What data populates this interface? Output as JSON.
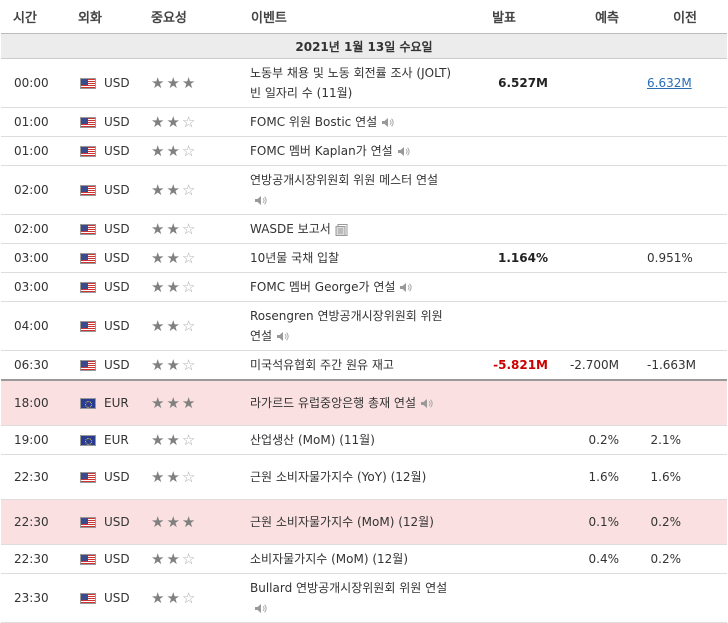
{
  "headers": {
    "time": "시간",
    "currency": "외화",
    "importance": "중요성",
    "event": "이벤트",
    "actual": "발표",
    "forecast": "예측",
    "previous": "이전"
  },
  "date_label": "2021년 1월 13일 수요일",
  "icons": {
    "us_flag": "us-flag-icon",
    "eu_flag": "eu-flag-icon",
    "star": "star-icon",
    "speaker": "speaker-icon",
    "document": "document-icon"
  },
  "colors": {
    "highlight_row": "#fae0e0",
    "negative": "#c00000",
    "link": "#2a6db5"
  },
  "rows": [
    {
      "time": "00:00",
      "flag": "us",
      "currency": "USD",
      "stars": 3,
      "event": "노동부 채용 및 노동 회전률 조사 (JOLT) 빈 일자리 수 (11월)",
      "icon": "",
      "actual": "6.527M",
      "actual_neg": false,
      "forecast": "",
      "previous": "6.632M",
      "previous_link": true,
      "hl": false
    },
    {
      "time": "01:00",
      "flag": "us",
      "currency": "USD",
      "stars": 2,
      "event": "FOMC 위원 Bostic 연설",
      "icon": "speaker",
      "actual": "",
      "forecast": "",
      "previous": "",
      "hl": false
    },
    {
      "time": "01:00",
      "flag": "us",
      "currency": "USD",
      "stars": 2,
      "event": "FOMC 멤버 Kaplan가 연설",
      "icon": "speaker",
      "actual": "",
      "forecast": "",
      "previous": "",
      "hl": false
    },
    {
      "time": "02:00",
      "flag": "us",
      "currency": "USD",
      "stars": 2,
      "event": "연방공개시장위원회 위원 메스터 연설",
      "icon": "speaker",
      "actual": "",
      "forecast": "",
      "previous": "",
      "hl": false
    },
    {
      "time": "02:00",
      "flag": "us",
      "currency": "USD",
      "stars": 2,
      "event": "WASDE 보고서",
      "icon": "document",
      "actual": "",
      "forecast": "",
      "previous": "",
      "hl": false
    },
    {
      "time": "03:00",
      "flag": "us",
      "currency": "USD",
      "stars": 2,
      "event": "10년물 국채 입찰",
      "icon": "",
      "actual": "1.164%",
      "actual_neg": false,
      "forecast": "",
      "previous": "0.951%",
      "hl": false
    },
    {
      "time": "03:00",
      "flag": "us",
      "currency": "USD",
      "stars": 2,
      "event": "FOMC 멤버 George가 연설",
      "icon": "speaker",
      "actual": "",
      "forecast": "",
      "previous": "",
      "hl": false
    },
    {
      "time": "04:00",
      "flag": "us",
      "currency": "USD",
      "stars": 2,
      "event": "Rosengren 연방공개시장위원회 위원 연설",
      "icon": "speaker",
      "actual": "",
      "forecast": "",
      "previous": "",
      "hl": false
    },
    {
      "time": "06:30",
      "flag": "us",
      "currency": "USD",
      "stars": 2,
      "event": "미국석유협회 주간 원유 재고",
      "icon": "",
      "actual": "-5.821M",
      "actual_neg": true,
      "forecast": "-2.700M",
      "previous": "-1.663M",
      "hl": false,
      "sep": true
    },
    {
      "time": "18:00",
      "flag": "eu",
      "currency": "EUR",
      "stars": 3,
      "event": "라가르드 유럽중앙은행 총재 연설",
      "icon": "speaker",
      "actual": "",
      "forecast": "",
      "previous": "",
      "hl": true
    },
    {
      "time": "19:00",
      "flag": "eu",
      "currency": "EUR",
      "stars": 2,
      "event": "산업생산 (MoM) (11월)",
      "icon": "",
      "actual": "",
      "forecast": "0.2%",
      "previous": "2.1%",
      "hl": false
    },
    {
      "time": "22:30",
      "flag": "us",
      "currency": "USD",
      "stars": 2,
      "event": "근원 소비자물가지수 (YoY) (12월)",
      "icon": "",
      "actual": "",
      "forecast": "1.6%",
      "previous": "1.6%",
      "hl": false
    },
    {
      "time": "22:30",
      "flag": "us",
      "currency": "USD",
      "stars": 3,
      "event": "근원 소비자물가지수 (MoM) (12월)",
      "icon": "",
      "actual": "",
      "forecast": "0.1%",
      "previous": "0.2%",
      "hl": true
    },
    {
      "time": "22:30",
      "flag": "us",
      "currency": "USD",
      "stars": 2,
      "event": "소비자물가지수 (MoM) (12월)",
      "icon": "",
      "actual": "",
      "forecast": "0.4%",
      "previous": "0.2%",
      "hl": false
    },
    {
      "time": "23:30",
      "flag": "us",
      "currency": "USD",
      "stars": 2,
      "event": "Bullard 연방공개시장위원회 위원 연설",
      "icon": "speaker",
      "actual": "",
      "forecast": "",
      "previous": "",
      "hl": false
    }
  ]
}
